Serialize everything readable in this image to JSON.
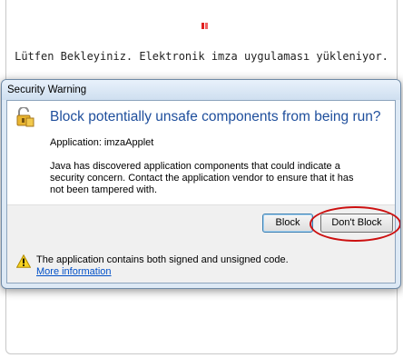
{
  "page": {
    "loading_text": "Lütfen Bekleyiniz. Elektronik imza uygulaması yükleniyor."
  },
  "dialog": {
    "title": "Security Warning",
    "headline": "Block potentially unsafe components from being run?",
    "application_line": "Application: imzaApplet",
    "message": "Java has discovered application components that could indicate a security concern. Contact the application vendor to ensure that it has not been tampered with.",
    "buttons": {
      "block": "Block",
      "dont_block": "Don't Block"
    },
    "footer": {
      "text": "The application contains both signed and unsigned code.",
      "link": "More information"
    }
  },
  "colors": {
    "headline": "#1e4e9c",
    "link": "#0050c8",
    "highlight_ellipse": "#cc1010",
    "loading_icon": "#e02020"
  },
  "icons": {
    "loading": "java-loading-icon",
    "dialog": "lock-shield-icon",
    "footer": "warning-icon"
  }
}
